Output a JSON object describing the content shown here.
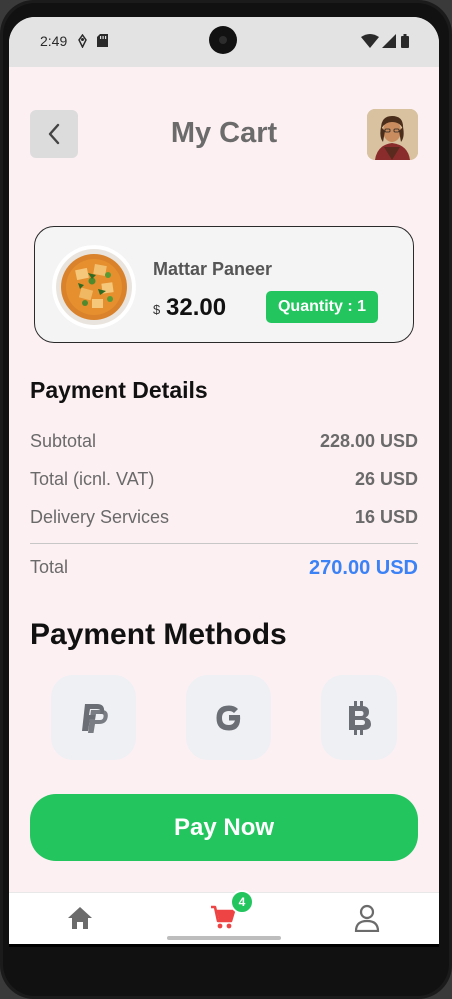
{
  "status_bar": {
    "time": "2:49",
    "icons": [
      "location-icon",
      "sd-card-icon",
      "wifi-icon",
      "signal-icon",
      "battery-icon"
    ]
  },
  "header": {
    "title": "My Cart",
    "back_icon": "chevron-left-icon",
    "avatar": "user-avatar"
  },
  "cart": {
    "items": [
      {
        "name": "Mattar Paneer",
        "currency_symbol": "$",
        "price": "32.00",
        "quantity_label": "Quantity : 1"
      }
    ]
  },
  "payment_details": {
    "title": "Payment Details",
    "rows": [
      {
        "label": "Subtotal",
        "value": "228.00 USD"
      },
      {
        "label": "Total (icnl. VAT)",
        "value": "26 USD"
      },
      {
        "label": "Delivery Services",
        "value": "16 USD"
      }
    ],
    "total": {
      "label": "Total",
      "value": "270.00 USD"
    }
  },
  "payment_methods": {
    "title": "Payment Methods",
    "options": [
      "paypal-icon",
      "google-icon",
      "bitcoin-icon"
    ]
  },
  "actions": {
    "pay_now_label": "Pay Now"
  },
  "bottom_nav": {
    "items": [
      "home-icon",
      "cart-icon",
      "profile-icon"
    ],
    "cart_badge": "4"
  },
  "colors": {
    "accent_green": "#22c55e",
    "total_blue": "#3b82f6",
    "background": "#fdf0f3",
    "cart_active": "#ef4444"
  }
}
